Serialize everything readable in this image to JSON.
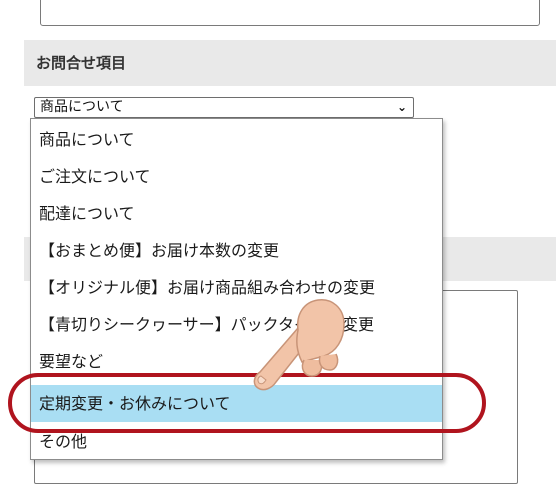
{
  "form": {
    "section_label": "お問合せ項目",
    "select_value": "商品について",
    "select_arrow": "⌄"
  },
  "dropdown": {
    "options": [
      "商品について",
      "ご注文について",
      "配達について",
      "【おまとめ便】お届け本数の変更",
      "【オリジナル便】お届け商品組み合わせの変更",
      "【青切りシークヮーサー】パックタイプへ変更",
      "要望など",
      "定期変更・お休みについて",
      "その他"
    ],
    "selected_index": 7
  },
  "colors": {
    "highlight": "#a9def3",
    "ring": "#b0141e",
    "hand_skin": "#f2c4a8"
  }
}
